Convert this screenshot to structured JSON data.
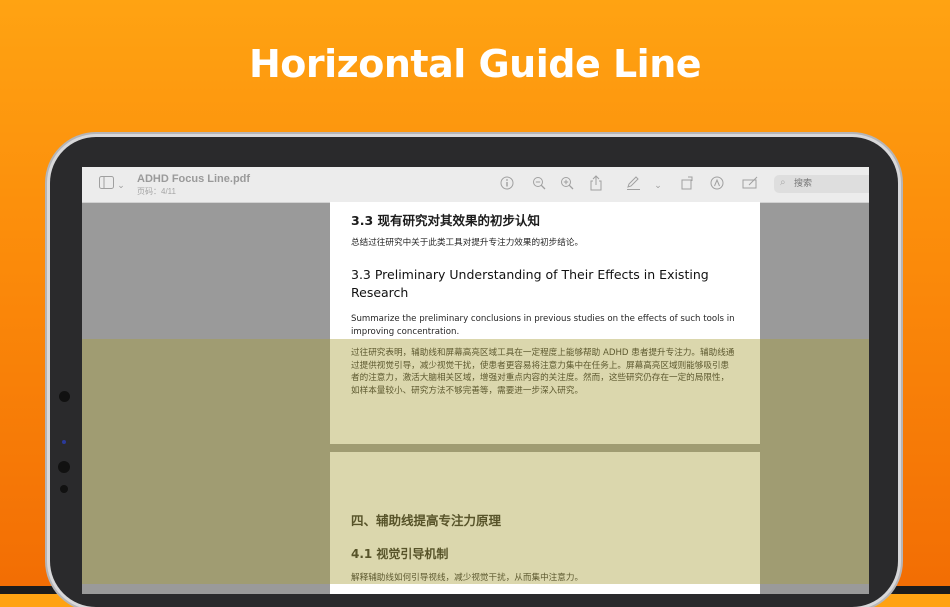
{
  "headline": "Horizontal Guide Line",
  "toolbar": {
    "file_name": "ADHD Focus Line.pdf",
    "page_indicator": "页码：4/11",
    "search_placeholder": "搜索",
    "icons": [
      "sidebar-toggle-icon",
      "chevron-down-icon",
      "info-icon",
      "zoom-out-icon",
      "zoom-in-icon",
      "share-icon",
      "markup-pen-icon",
      "chevron-down-icon",
      "rotate-icon",
      "annotate-icon",
      "redact-icon",
      "search-icon"
    ]
  },
  "document": {
    "page1": {
      "heading_cn": "3.3 现有研究对其效果的初步认知",
      "summary_cn": "总结过往研究中关于此类工具对提升专注力效果的初步结论。",
      "heading_en": "3.3 Preliminary Understanding of Their Effects in Existing Research",
      "summary_en": "Summarize the preliminary conclusions in previous studies on the effects of such tools in improving concentration.",
      "body_cn": "过往研究表明，辅助线和屏幕高亮区域工具在一定程度上能够帮助 ADHD 患者提升专注力。辅助线通过提供视觉引导，减少视觉干扰，使患者更容易将注意力集中在任务上。屏幕高亮区域则能够吸引患者的注意力，激活大脑相关区域，增强对重点内容的关注度。然而，这些研究仍存在一定的局限性，如样本量较小、研究方法不够完善等，需要进一步深入研究。"
    },
    "page2": {
      "section_cn": "四、辅助线提高专注力原理",
      "subheading_cn": "4.1 视觉引导机制",
      "body_cn": "解释辅助线如何引导视线，减少视觉干扰，从而集中注意力。"
    }
  },
  "colors": {
    "background_top": "#ffa312",
    "background_bottom": "#f26d04",
    "focus_band": "#aaa03c"
  }
}
